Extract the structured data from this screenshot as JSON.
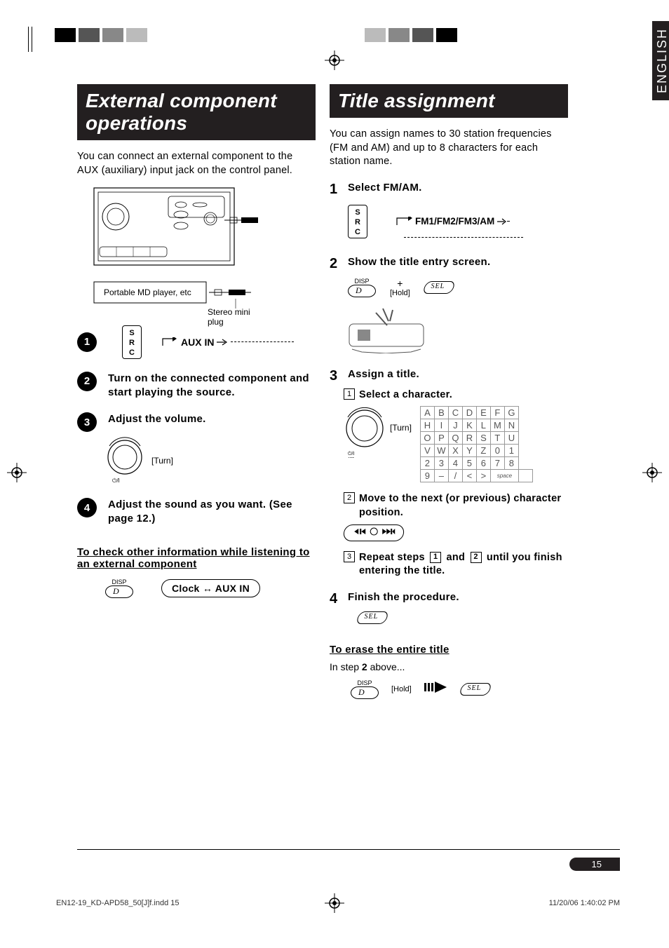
{
  "side_tab": "ENGLISH",
  "page_number": "15",
  "footer": {
    "file": "EN12-19_KD-APD58_50[J]f.indd   15",
    "timestamp": "11/20/06   1:40:02 PM"
  },
  "left": {
    "headline": "External component operations",
    "intro": "You can connect an external component to the AUX (auxiliary) input jack on the control panel.",
    "fig": {
      "device_label": "Portable MD player, etc",
      "plug_label": "Stereo mini plug"
    },
    "src_label": "S\nR\nC",
    "aux_in": "AUX IN",
    "steps": {
      "s2": "Turn on the connected component and start playing the source.",
      "s3": "Adjust the volume.",
      "s3_turn": "[Turn]",
      "s4": "Adjust the sound as you want. (See page 12.)"
    },
    "check_heading": "To check other information while listening to an external component",
    "disp_label": "DISP",
    "toggle_box": "Clock ↔ AUX IN"
  },
  "right": {
    "headline": "Title assignment",
    "intro": "You can assign names to 30 station frequencies (FM and AM) and up to 8 characters for each station name.",
    "steps": {
      "s1": "Select FM/AM.",
      "s1_box": "FM1/FM2/FM3/AM",
      "s2": "Show the title entry screen.",
      "s2_hold": "[Hold]",
      "s2_plus": "+",
      "s3": "Assign a title.",
      "s3_sub1": "Select a character.",
      "s3_turn": "[Turn]",
      "s3_sub2": "Move to the next (or previous) character position.",
      "s3_sub3_a": "Repeat steps ",
      "s3_sub3_b": " and ",
      "s3_sub3_c": " until you finish entering the title.",
      "s4": "Finish the procedure."
    },
    "erase_heading": "To erase the entire title",
    "erase_intro_a": "In step ",
    "erase_intro_b": "2",
    "erase_intro_c": " above...",
    "erase_hold": "[Hold]"
  },
  "char_grid": [
    [
      "A",
      "B",
      "C",
      "D",
      "E",
      "F",
      "G"
    ],
    [
      "H",
      "I",
      "J",
      "K",
      "L",
      "M",
      "N"
    ],
    [
      "O",
      "P",
      "Q",
      "R",
      "S",
      "T",
      "U"
    ],
    [
      "V",
      "W",
      "X",
      "Y",
      "Z",
      "0",
      "1"
    ],
    [
      "2",
      "3",
      "4",
      "5",
      "6",
      "7",
      "8"
    ],
    [
      "9",
      "–",
      "/",
      "<",
      ">",
      "space",
      ""
    ]
  ]
}
